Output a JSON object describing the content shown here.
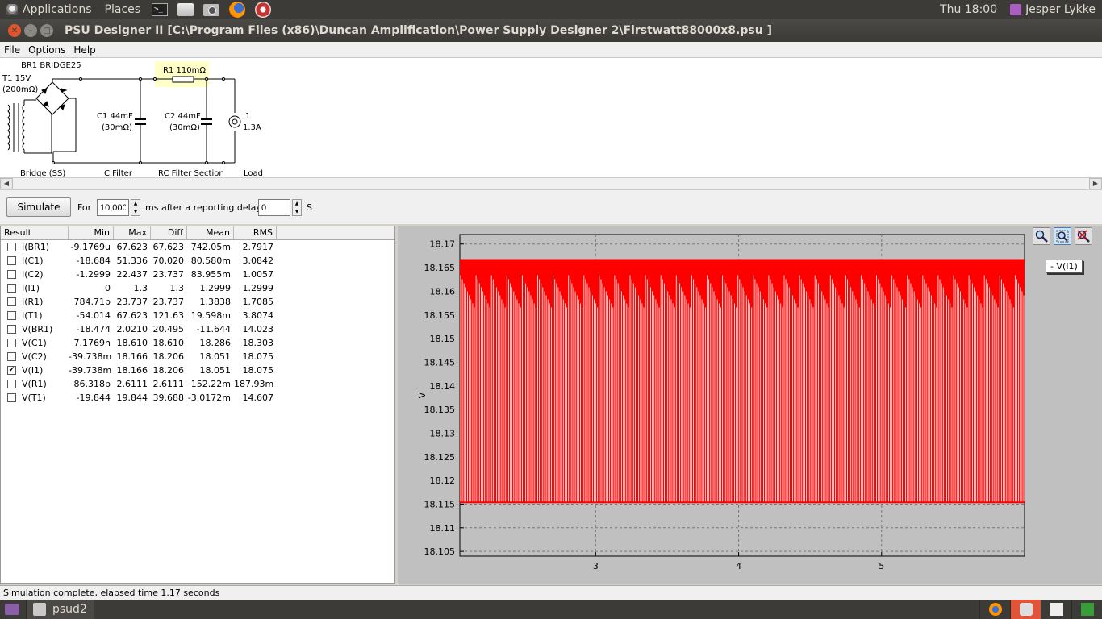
{
  "top_panel": {
    "applications": "Applications",
    "places": "Places",
    "clock": "Thu 18:00",
    "user": "Jesper Lykke"
  },
  "window": {
    "title": "PSU Designer II  [C:\\Program Files (x86)\\Duncan Amplification\\Power Supply Designer 2\\Firstwatt88000x8.psu ]"
  },
  "menu": [
    "File",
    "Options",
    "Help"
  ],
  "schematic": {
    "br1": "BR1 BRIDGE25",
    "t1_a": "T1 15V",
    "t1_b": "(200mΩ)",
    "r1": "R1 110mΩ",
    "c1_a": "C1 44mF",
    "c1_b": "(30mΩ)",
    "c2_a": "C2 44mF",
    "c2_b": "(30mΩ)",
    "i1_a": "I1",
    "i1_b": "1.3A",
    "sec_bridge": "Bridge (SS)",
    "sec_cfilter": "C Filter",
    "sec_rc": "RC Filter Section",
    "sec_load": "Load"
  },
  "sim": {
    "button": "Simulate",
    "for_label": "For",
    "duration": "10,000",
    "ms_label": "ms",
    "delay_label": "after a reporting delay of",
    "delay": "0",
    "s_label": "S"
  },
  "results": {
    "headers": [
      "Result",
      "Min",
      "Max",
      "Diff",
      "Mean",
      "RMS"
    ],
    "rows": [
      {
        "name": "I(BR1)",
        "checked": false,
        "min": "-9.1769u",
        "max": "67.623",
        "diff": "67.623",
        "mean": "742.05m",
        "rms": "2.7917"
      },
      {
        "name": "I(C1)",
        "checked": false,
        "min": "-18.684",
        "max": "51.336",
        "diff": "70.020",
        "mean": "80.580m",
        "rms": "3.0842"
      },
      {
        "name": "I(C2)",
        "checked": false,
        "min": "-1.2999",
        "max": "22.437",
        "diff": "23.737",
        "mean": "83.955m",
        "rms": "1.0057"
      },
      {
        "name": "I(I1)",
        "checked": false,
        "min": "0",
        "max": "1.3",
        "diff": "1.3",
        "mean": "1.2999",
        "rms": "1.2999"
      },
      {
        "name": "I(R1)",
        "checked": false,
        "min": "784.71p",
        "max": "23.737",
        "diff": "23.737",
        "mean": "1.3838",
        "rms": "1.7085"
      },
      {
        "name": "I(T1)",
        "checked": false,
        "min": "-54.014",
        "max": "67.623",
        "diff": "121.63",
        "mean": "19.598m",
        "rms": "3.8074"
      },
      {
        "name": "V(BR1)",
        "checked": false,
        "min": "-18.474",
        "max": "2.0210",
        "diff": "20.495",
        "mean": "-11.644",
        "rms": "14.023"
      },
      {
        "name": "V(C1)",
        "checked": false,
        "min": "7.1769n",
        "max": "18.610",
        "diff": "18.610",
        "mean": "18.286",
        "rms": "18.303"
      },
      {
        "name": "V(C2)",
        "checked": false,
        "min": "-39.738m",
        "max": "18.166",
        "diff": "18.206",
        "mean": "18.051",
        "rms": "18.075"
      },
      {
        "name": "V(I1)",
        "checked": true,
        "min": "-39.738m",
        "max": "18.166",
        "diff": "18.206",
        "mean": "18.051",
        "rms": "18.075"
      },
      {
        "name": "V(R1)",
        "checked": false,
        "min": "86.318p",
        "max": "2.6111",
        "diff": "2.6111",
        "mean": "152.22m",
        "rms": "187.93m"
      },
      {
        "name": "V(T1)",
        "checked": false,
        "min": "-19.844",
        "max": "19.844",
        "diff": "39.688",
        "mean": "-3.0172m",
        "rms": "14.607"
      }
    ]
  },
  "chart_data": {
    "type": "line",
    "ylabel": "V",
    "xlabel": "",
    "ylim": [
      18.104,
      18.172
    ],
    "xlim": [
      2.05,
      6.0
    ],
    "yticks": [
      "18.17",
      "18.165",
      "18.16",
      "18.155",
      "18.15",
      "18.145",
      "18.14",
      "18.135",
      "18.13",
      "18.125",
      "18.12",
      "18.115",
      "18.11",
      "18.105"
    ],
    "xticks": [
      "3",
      "4",
      "5"
    ],
    "grid": true,
    "legend_placement": "top-right",
    "series": [
      {
        "name": "V(I1)",
        "color": "#ff0000",
        "peak": 18.1668,
        "trough": 18.1152,
        "ripple_period": 0.01
      }
    ]
  },
  "status": "Simulation complete, elapsed time 1.17 seconds",
  "taskbar": {
    "task": "psud2"
  }
}
